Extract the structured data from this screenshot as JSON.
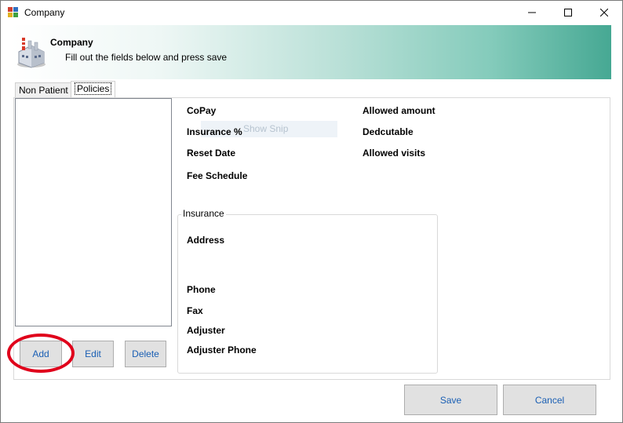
{
  "window": {
    "title": "Company",
    "app_icon": "app-window-icon"
  },
  "titlebar_buttons": {
    "minimize": "—",
    "maximize": "☐",
    "close": "✕"
  },
  "banner": {
    "title": "Company",
    "subtitle": "Fill out the fields below and press save",
    "icon": "factory-icon"
  },
  "tabs": [
    {
      "label": "Non Patient",
      "active": false
    },
    {
      "label": "Policies",
      "active": true
    }
  ],
  "policy_buttons": {
    "add": "Add",
    "edit": "Edit",
    "delete": "Delete"
  },
  "fields_left": {
    "copay": "CoPay",
    "insurance_pct": "Insurance %",
    "reset_date": "Reset Date",
    "fee_schedule": "Fee Schedule"
  },
  "fields_right": {
    "allowed_amount": "Allowed amount",
    "deductible": "Dedcutable",
    "allowed_visits": "Allowed visits"
  },
  "overlay_text": "Show Snip",
  "insurance_group": {
    "title": "Insurance",
    "address": "Address",
    "phone": "Phone",
    "fax": "Fax",
    "adjuster": "Adjuster",
    "adjuster_phone": "Adjuster Phone"
  },
  "footer_buttons": {
    "save": "Save",
    "cancel": "Cancel"
  },
  "colors": {
    "banner_end": "#46a893",
    "highlight": "#e0001b",
    "button_text": "#1a5fb4"
  }
}
